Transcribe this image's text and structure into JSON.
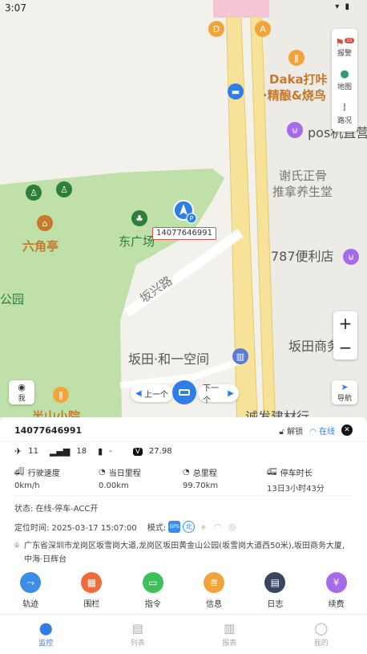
{
  "status_bar": {
    "time": "3:07"
  },
  "map": {
    "labels": {
      "daka_line1": "Daka打咔",
      "daka_line2": "·精酿&烧鸟",
      "pos": "pos机直营",
      "xie_line1": "谢氏正骨",
      "xie_line2": "推拿养生堂",
      "liujiaoting": "六角亭",
      "dongguangchang": "东广场",
      "gongyuan": "公园",
      "bianlidian": "787便利店",
      "banxinglu": "坂兴路",
      "kongjian": "坂田·和一空间",
      "shangwu": "坂田商务大",
      "banshan": "半山小院",
      "jiancai": "诚发建材行",
      "exit_d": "D",
      "exit_a": "A"
    },
    "vehicle_plate": "14077646991",
    "tools": {
      "alarm_label": "报警",
      "alarm_badge": "15",
      "map_label": "地图",
      "traffic_label": "路况"
    },
    "zoom_in": "+",
    "zoom_out": "−",
    "me_label": "我",
    "nav_label": "导航",
    "prev_label": "上一个",
    "next_label": "下一个"
  },
  "panel": {
    "device_id": "14077646991",
    "unlock_label": "解锁",
    "online_label": "在线",
    "satellites": "11",
    "signal": "18",
    "battery": "-",
    "voltage": "27.98",
    "metrics": [
      {
        "label": "行驶速度",
        "value": "0km/h"
      },
      {
        "label": "当日里程",
        "value": "0.00km"
      },
      {
        "label": "总里程",
        "value": "99.70km"
      },
      {
        "label": "停车时长",
        "value": "13日3小时43分"
      }
    ],
    "state_text": "状态: 在线-停车-ACC开",
    "locate_time": "定位时间: 2025-03-17 15:07:00",
    "mode_label": "模式:",
    "mode_gps": "GPS",
    "mode_bd": "北",
    "address": "广东省深圳市龙岗区坂雪岗大道,龙岗区坂田黄金山公园(坂雪岗大道西50米),坂田商务大厦,中海·日辉台",
    "actions": [
      {
        "label": "轨迹",
        "color": "#3b8ee8"
      },
      {
        "label": "围栏",
        "color": "#f06a3a"
      },
      {
        "label": "指令",
        "color": "#3dbf5a"
      },
      {
        "label": "信息",
        "color": "#f2a43a"
      },
      {
        "label": "日志",
        "color": "#3a4660"
      },
      {
        "label": "续费",
        "color": "#a46ae8"
      }
    ]
  },
  "tabbar": {
    "tabs": [
      {
        "label": "监控"
      },
      {
        "label": "列表"
      },
      {
        "label": "报表"
      },
      {
        "label": "我的"
      }
    ]
  },
  "colors": {
    "accent": "#2f7ee8",
    "park": "#bfe0a8",
    "road": "#f7e29a"
  }
}
